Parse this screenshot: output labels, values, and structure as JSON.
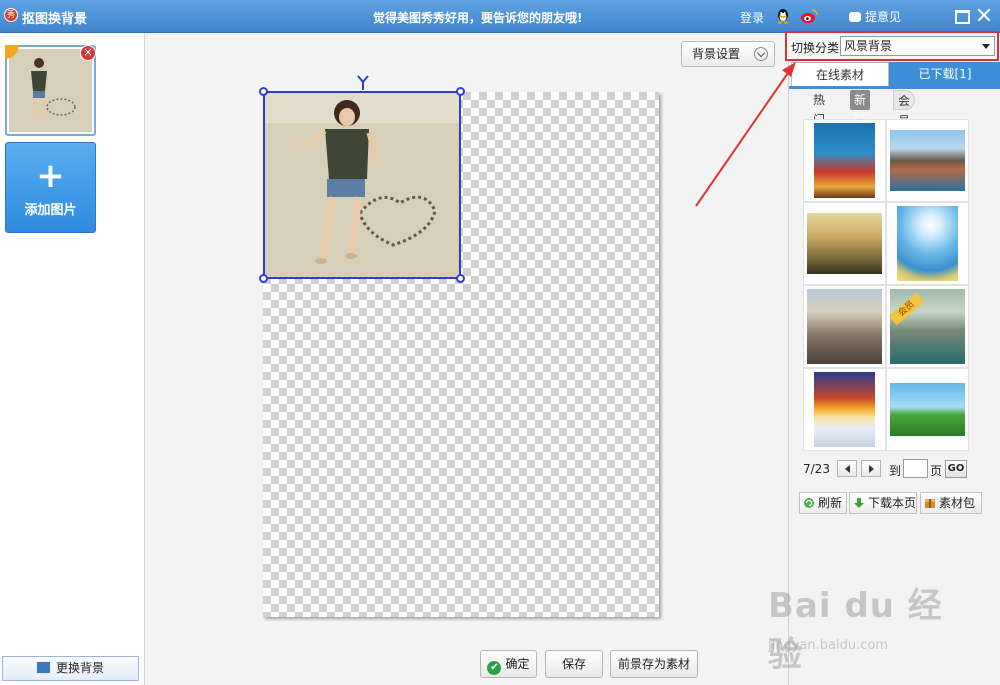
{
  "titlebar": {
    "app_icon_glyph": "秀",
    "title": "抠图换背景",
    "slogan": "觉得美图秀秀好用，要告诉您的朋友哦!",
    "login": "登录",
    "feedback": "提意见",
    "qq_icon": "qq-penguin-icon",
    "weibo_icon": "weibo-icon"
  },
  "left_panel": {
    "add_image_label": "添加图片",
    "add_image_plus": "+",
    "remove_glyph": "×",
    "change_background": "更换背景"
  },
  "workspace": {
    "background_settings": "背景设置",
    "ok_button": "确定",
    "ok_check": "✔",
    "save_button": "保存",
    "save_foreground_button": "前景存为素材"
  },
  "right_panel": {
    "category_label": "切换分类",
    "category_value": "风景背景",
    "tabs": {
      "online": "在线素材",
      "downloaded": "已下载[1]"
    },
    "subtabs": {
      "hot": "热门",
      "new": "新鲜",
      "vip": "会员独享"
    },
    "vip_ribbon": "会员",
    "pager": {
      "page_indicator": "7/23",
      "goto_label": "到",
      "page_label": "页",
      "go_button": "GO",
      "page_input_value": ""
    },
    "actions": {
      "refresh": "刷新",
      "download_page": "下载本页",
      "material_pack": "素材包"
    }
  },
  "watermark": {
    "main": "Bai du 经验",
    "sub": "jingyan.baidu.com"
  },
  "colors": {
    "titlebar_blue": "#3f86cf",
    "accent_blue": "#3c8fd9",
    "selection_blue": "#2b3ed0",
    "highlight_red": "#e02f2f"
  }
}
